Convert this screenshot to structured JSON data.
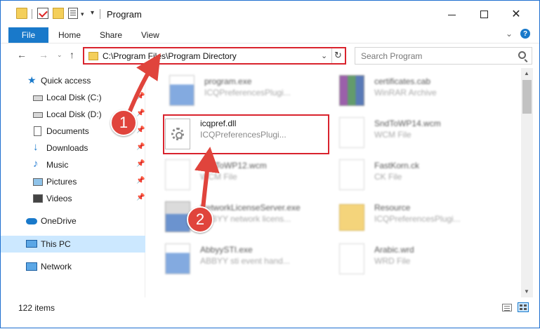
{
  "window": {
    "title": "Program",
    "controls": {
      "minimize": "–",
      "maximize": "□",
      "close": "✕"
    }
  },
  "ribbon": {
    "tabs": {
      "file": "File",
      "home": "Home",
      "share": "Share",
      "view": "View"
    },
    "help": "?"
  },
  "nav": {
    "address": "C:\\Program Files\\Program Directory",
    "search_placeholder": "Search Program"
  },
  "sidebar": {
    "items": [
      {
        "label": "Quick access",
        "icon": "star-icon"
      },
      {
        "label": "Local Disk (C:)",
        "icon": "disk-icon",
        "pinned": true
      },
      {
        "label": "Local Disk (D:)",
        "icon": "disk-icon",
        "pinned": true
      },
      {
        "label": "Documents",
        "icon": "documents-icon",
        "pinned": true
      },
      {
        "label": "Downloads",
        "icon": "download-icon",
        "pinned": true
      },
      {
        "label": "Music",
        "icon": "music-icon",
        "pinned": true
      },
      {
        "label": "Pictures",
        "icon": "pictures-icon",
        "pinned": true
      },
      {
        "label": "Videos",
        "icon": "videos-icon",
        "pinned": true
      },
      {
        "label": "OneDrive",
        "icon": "cloud-icon"
      },
      {
        "label": "This PC",
        "icon": "computer-icon",
        "selected": true
      },
      {
        "label": "Network",
        "icon": "network-icon"
      }
    ]
  },
  "files": [
    {
      "name": "program.exe",
      "desc": "ICQPreferencesPlugi...",
      "thumb": "exe",
      "blurred": true
    },
    {
      "name": "certificates.cab",
      "desc": "WinRAR Archive",
      "thumb": "rar",
      "blurred": true
    },
    {
      "name": "icqpref.dll",
      "desc": "ICQPreferencesPlugi...",
      "thumb": "dll",
      "blurred": false
    },
    {
      "name": "SndToWP14.wcm",
      "desc": "WCM File",
      "thumb": "page",
      "blurred": true
    },
    {
      "name": "SndToWP12.wcm",
      "desc": "WCM File",
      "thumb": "page",
      "blurred": true
    },
    {
      "name": "FastKorn.ck",
      "desc": "CK File",
      "thumb": "page",
      "blurred": true
    },
    {
      "name": "NetworkLicenseServer.exe",
      "desc": "ABBYY network licens...",
      "thumb": "server",
      "blurred": true
    },
    {
      "name": "Resource",
      "desc": "ICQPreferencesPlugi...",
      "thumb": "folder",
      "blurred": true
    },
    {
      "name": "AbbyySTI.exe",
      "desc": "ABBYY sti event hand...",
      "thumb": "exe",
      "blurred": true
    },
    {
      "name": "Arabic.wrd",
      "desc": "WRD File",
      "thumb": "page",
      "blurred": true
    }
  ],
  "status": {
    "items_count": "122 items"
  },
  "annotations": {
    "step1": "1",
    "step2": "2",
    "accent": "#d9232d"
  }
}
